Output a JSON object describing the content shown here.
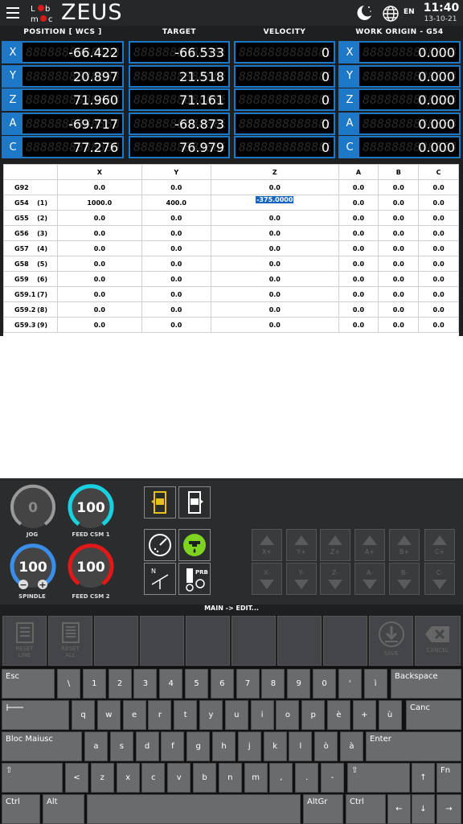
{
  "header": {
    "brand": "ZEUS",
    "lang": "EN",
    "time": "11:40",
    "date": "13-10-21"
  },
  "dro": {
    "headers": [
      "POSITION [ WCS ]",
      "TARGET",
      "VELOCITY",
      "WORK ORIGIN - G54"
    ],
    "axes": [
      "X",
      "Y",
      "Z",
      "A",
      "C"
    ],
    "position": [
      "-66.422",
      "20.897",
      "71.960",
      "-69.717",
      "77.276"
    ],
    "target": [
      "-66.533",
      "21.518",
      "71.161",
      "-68.873",
      "76.979"
    ],
    "velocity": [
      "0",
      "0",
      "0",
      "0",
      "0"
    ],
    "origin": [
      "0.000",
      "0.000",
      "0.000",
      "0.000",
      "0.000"
    ]
  },
  "offsets": {
    "columns": [
      "X",
      "Y",
      "Z",
      "A",
      "B",
      "C"
    ],
    "rows": [
      {
        "name": "G92",
        "idx": "",
        "values": [
          "0.0",
          "0.0",
          "0.0",
          "0.0",
          "0.0",
          "0.0"
        ]
      },
      {
        "name": "G54",
        "idx": "(1)",
        "values": [
          "1000.0",
          "400.0",
          "-375.0000",
          "0.0",
          "0.0",
          "0.0"
        ]
      },
      {
        "name": "G55",
        "idx": "(2)",
        "values": [
          "0.0",
          "0.0",
          "0.0",
          "0.0",
          "0.0",
          "0.0"
        ]
      },
      {
        "name": "G56",
        "idx": "(3)",
        "values": [
          "0.0",
          "0.0",
          "0.0",
          "0.0",
          "0.0",
          "0.0"
        ]
      },
      {
        "name": "G57",
        "idx": "(4)",
        "values": [
          "0.0",
          "0.0",
          "0.0",
          "0.0",
          "0.0",
          "0.0"
        ]
      },
      {
        "name": "G58",
        "idx": "(5)",
        "values": [
          "0.0",
          "0.0",
          "0.0",
          "0.0",
          "0.0",
          "0.0"
        ]
      },
      {
        "name": "G59",
        "idx": "(6)",
        "values": [
          "0.0",
          "0.0",
          "0.0",
          "0.0",
          "0.0",
          "0.0"
        ]
      },
      {
        "name": "G59.1",
        "idx": "(7)",
        "values": [
          "0.0",
          "0.0",
          "0.0",
          "0.0",
          "0.0",
          "0.0"
        ]
      },
      {
        "name": "G59.2",
        "idx": "(8)",
        "values": [
          "0.0",
          "0.0",
          "0.0",
          "0.0",
          "0.0",
          "0.0"
        ]
      },
      {
        "name": "G59.3",
        "idx": "(9)",
        "values": [
          "0.0",
          "0.0",
          "0.0",
          "0.0",
          "0.0",
          "0.0"
        ]
      }
    ]
  },
  "gauges": {
    "jog": {
      "value": "0",
      "label": "JOG",
      "color": "#9a9a9a"
    },
    "feed1": {
      "value": "100",
      "label": "FEED CSM 1",
      "color": "#19d0e0"
    },
    "spindle": {
      "value": "100",
      "label": "SPINDLE",
      "color": "#3a8ee8"
    },
    "feed2": {
      "value": "100",
      "label": "FEED CSM 2",
      "color": "#e01818"
    }
  },
  "jog_buttons": {
    "plus": [
      "X+",
      "Y+",
      "Z+",
      "A+",
      "B+",
      "C+"
    ],
    "minus": [
      "X-",
      "Y-",
      "Z-",
      "A-",
      "B-",
      "C-"
    ]
  },
  "mode": "MAIN -> EDIT...",
  "softkeys": {
    "reset_line": "RESET LINE",
    "reset_all": "RESET ALL",
    "save": "SAVE",
    "cancel": "CANCEL"
  },
  "keyboard": {
    "esc": "Esc",
    "backspace": "Backspace",
    "canc": "Canc",
    "caps": "Bloc Maiusc",
    "enter": "Enter",
    "ctrl": "Ctrl",
    "alt": "Alt",
    "altgr": "AltGr",
    "fn": "Fn",
    "row1": [
      "\\",
      "1",
      "2",
      "3",
      "4",
      "5",
      "6",
      "7",
      "8",
      "9",
      "0",
      "'",
      "ì"
    ],
    "row2": [
      "q",
      "w",
      "e",
      "r",
      "t",
      "y",
      "u",
      "i",
      "o",
      "p",
      "è",
      "+",
      "ù"
    ],
    "row3": [
      "a",
      "s",
      "d",
      "f",
      "g",
      "h",
      "j",
      "k",
      "l",
      "ò",
      "à"
    ],
    "row4": [
      "<",
      "z",
      "x",
      "c",
      "v",
      "b",
      "n",
      "m",
      ",",
      ".",
      "-"
    ],
    "arrows": [
      "↑",
      "←",
      "↓",
      "→"
    ]
  },
  "colors": {
    "accent": "#1e78c8",
    "yellow": "#e8c21a",
    "green": "#7ed321"
  }
}
